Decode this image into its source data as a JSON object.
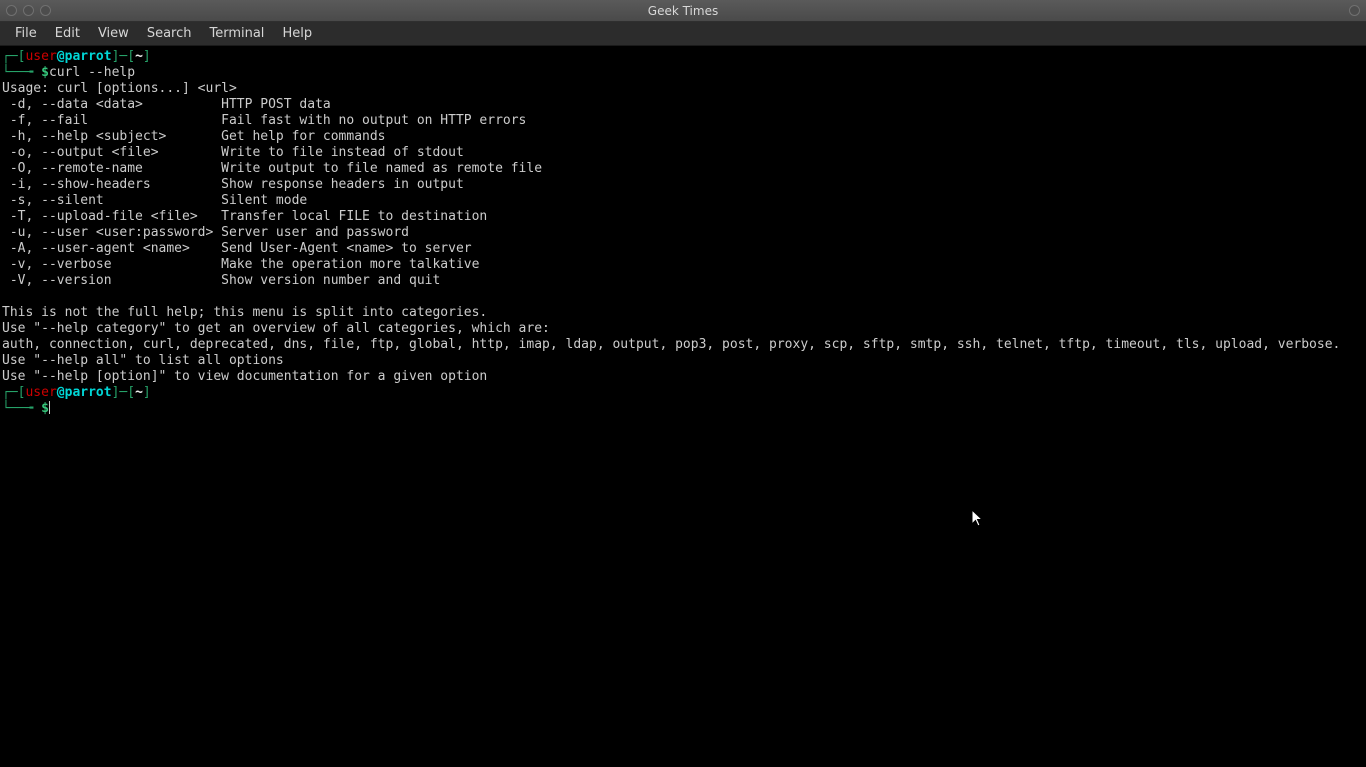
{
  "window": {
    "title": "Geek Times"
  },
  "menu": {
    "file": "File",
    "edit": "Edit",
    "view": "View",
    "search": "Search",
    "terminal": "Terminal",
    "help": "Help"
  },
  "prompt": {
    "lbracket": "┌─[",
    "user": "user",
    "at": "@",
    "host": "parrot",
    "rbracket": "]─[",
    "path": "~",
    "close": "]",
    "line2_prefix": "└──╼ ",
    "dollar": "$"
  },
  "command1": "curl --help",
  "output": {
    "usage": "Usage: curl [options...] <url>",
    "rows": [
      {
        "flag": " -d, --data <data>          ",
        "desc": "HTTP POST data"
      },
      {
        "flag": " -f, --fail                 ",
        "desc": "Fail fast with no output on HTTP errors"
      },
      {
        "flag": " -h, --help <subject>       ",
        "desc": "Get help for commands"
      },
      {
        "flag": " -o, --output <file>        ",
        "desc": "Write to file instead of stdout"
      },
      {
        "flag": " -O, --remote-name          ",
        "desc": "Write output to file named as remote file"
      },
      {
        "flag": " -i, --show-headers         ",
        "desc": "Show response headers in output"
      },
      {
        "flag": " -s, --silent               ",
        "desc": "Silent mode"
      },
      {
        "flag": " -T, --upload-file <file>   ",
        "desc": "Transfer local FILE to destination"
      },
      {
        "flag": " -u, --user <user:password> ",
        "desc": "Server user and password"
      },
      {
        "flag": " -A, --user-agent <name>    ",
        "desc": "Send User-Agent <name> to server"
      },
      {
        "flag": " -v, --verbose              ",
        "desc": "Make the operation more talkative"
      },
      {
        "flag": " -V, --version              ",
        "desc": "Show version number and quit"
      }
    ],
    "footer1": "This is not the full help; this menu is split into categories.",
    "footer2": "Use \"--help category\" to get an overview of all categories, which are:",
    "categories": "auth, connection, curl, deprecated, dns, file, ftp, global, http, imap, ldap, output, pop3, post, proxy, scp, sftp, smtp, ssh, telnet, tftp, timeout, tls, upload, verbose.",
    "footer3": "Use \"--help all\" to list all options",
    "footer4": "Use \"--help [option]\" to view documentation for a given option"
  }
}
